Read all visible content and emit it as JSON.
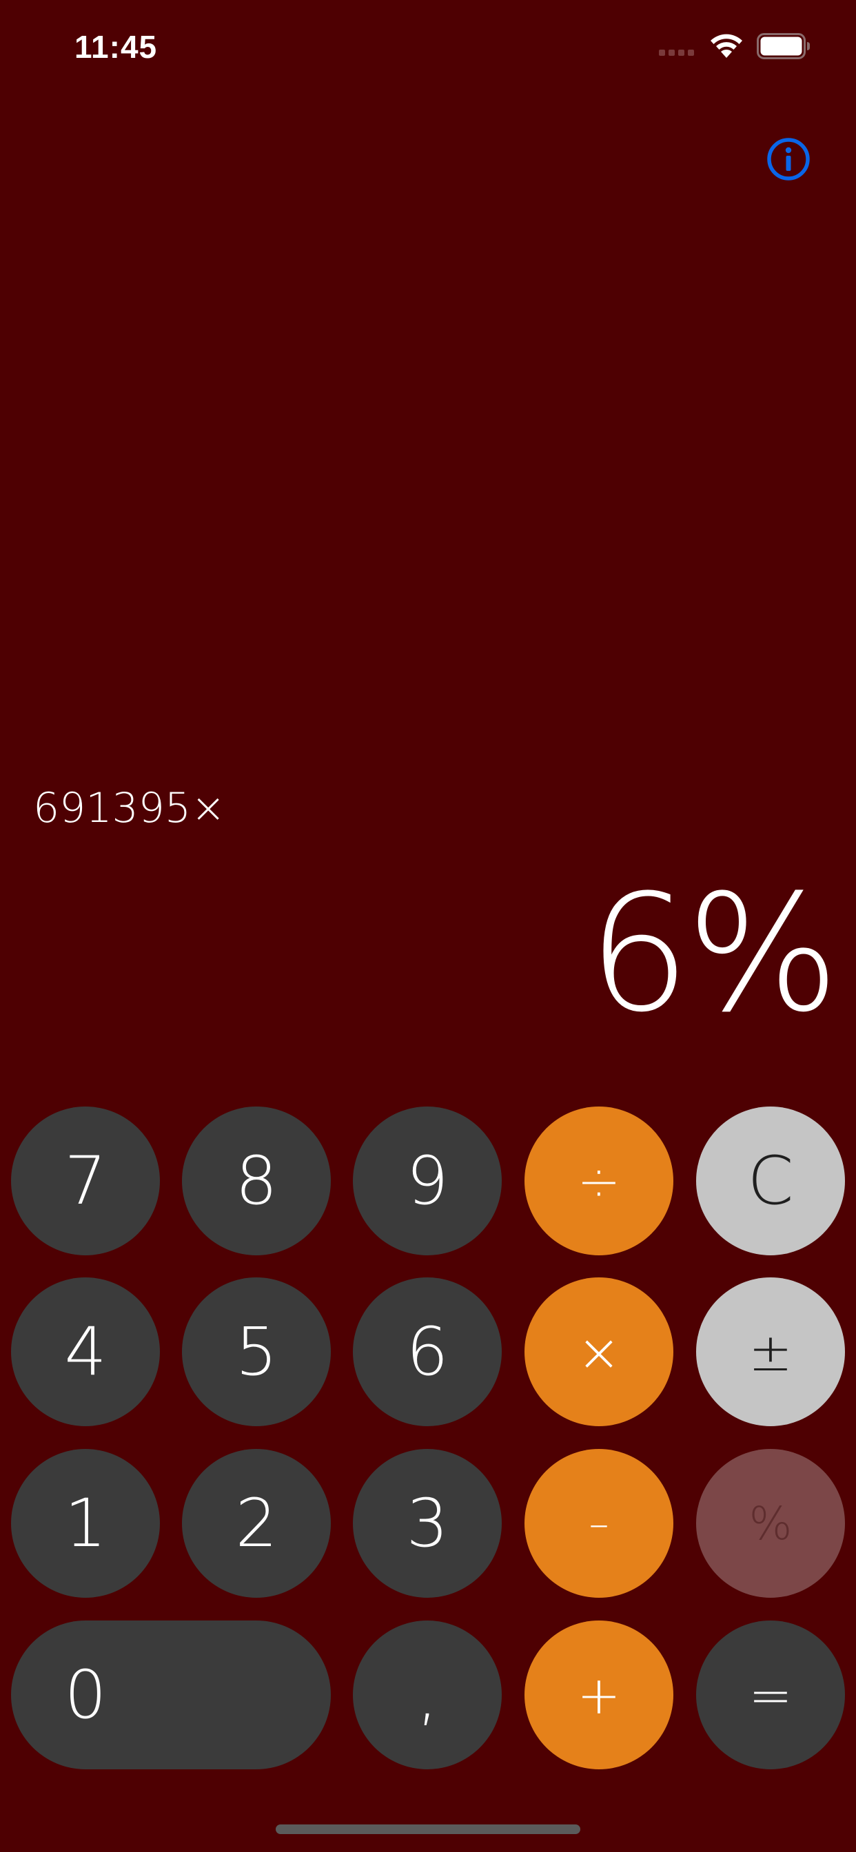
{
  "status_bar": {
    "time": "11:45",
    "icons": [
      "signal-dots-icon",
      "wifi-icon",
      "battery-icon"
    ]
  },
  "header": {
    "info_icon": "info-icon",
    "info_color": "#0a66e8"
  },
  "display": {
    "expression": "691395×",
    "value": "6%"
  },
  "keypad": {
    "rows": [
      [
        {
          "label": "7"
        },
        {
          "label": "8"
        },
        {
          "label": "9"
        },
        {
          "label": "÷"
        },
        {
          "label": "C"
        }
      ],
      [
        {
          "label": "4"
        },
        {
          "label": "5"
        },
        {
          "label": "6"
        },
        {
          "label": "×"
        },
        {
          "label": "±"
        }
      ],
      [
        {
          "label": "1"
        },
        {
          "label": "2"
        },
        {
          "label": "3"
        },
        {
          "label": "–"
        },
        {
          "label": "%"
        }
      ],
      [
        {
          "label": "0"
        },
        {
          "label": ","
        },
        {
          "label": "+"
        },
        {
          "label": "="
        }
      ]
    ]
  },
  "colors": {
    "background": "#4e0002",
    "digit_key": "#3b3b3b",
    "operator_key": "#e5811a",
    "function_key": "#c5c5c5",
    "disabled_key": "#7c4748"
  }
}
